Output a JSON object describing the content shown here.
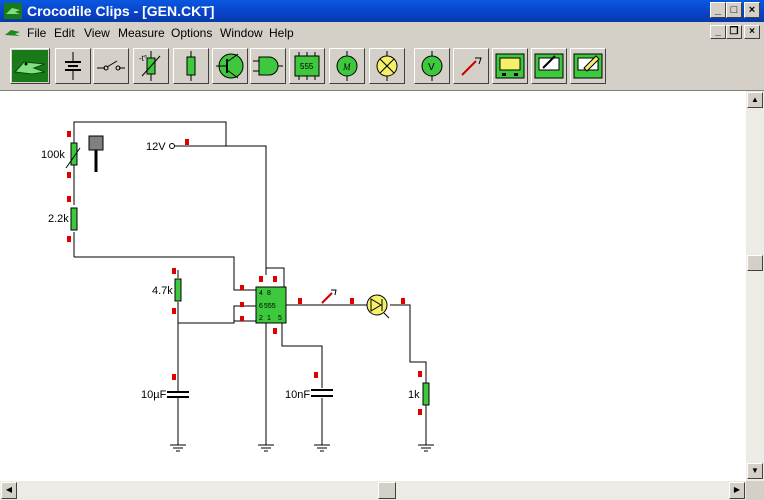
{
  "window": {
    "title": "Crocodile Clips - [GEN.CKT]"
  },
  "menu": [
    "File",
    "Edit",
    "View",
    "Measure",
    "Options",
    "Window",
    "Help"
  ],
  "toolbar": [
    "crocodile-logo-icon",
    "battery-icon",
    "switch-icon",
    "variable-resistor-icon",
    "resistor-icon",
    "transistor-icon",
    "and-gate-icon",
    "ic-555-icon",
    "ammeter-icon",
    "lamp-icon",
    "voltmeter-icon",
    "probe-icon",
    "oscilloscope-icon",
    "graph-icon",
    "chart-recorder-icon"
  ],
  "toolbar_text": {
    "ic_label": "555"
  },
  "circuit": {
    "labels": {
      "r_var": "100k",
      "r1": "2.2k",
      "r2": "4.7k",
      "c1": "10µF",
      "c2": "10nF",
      "r3": "1k",
      "supply": "12V"
    },
    "ic": {
      "label": "555",
      "pins": [
        "4",
        "8",
        "7",
        "6",
        "3",
        "2",
        "1",
        "5"
      ]
    }
  }
}
